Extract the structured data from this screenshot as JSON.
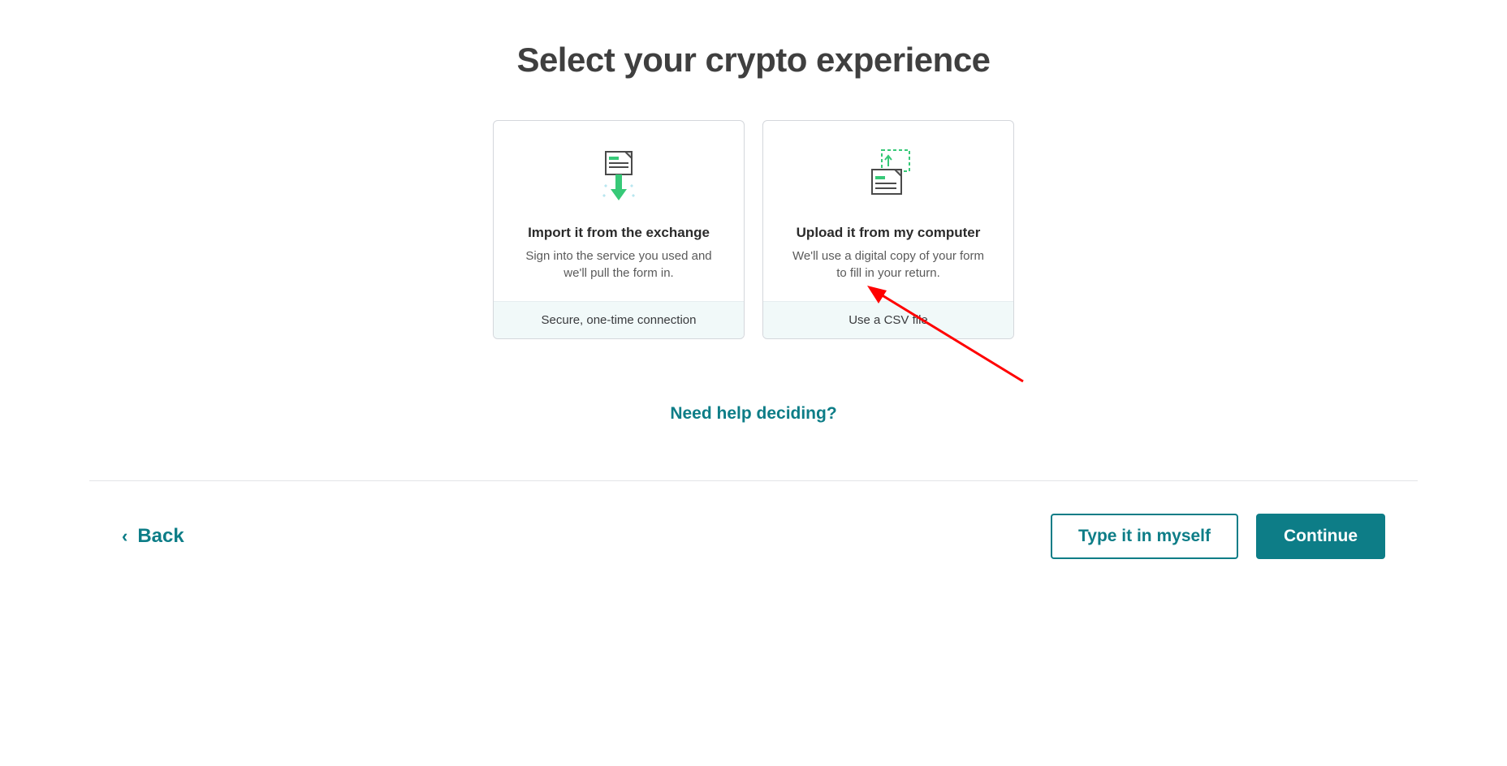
{
  "page": {
    "title": "Select your crypto experience"
  },
  "cards": {
    "import": {
      "title": "Import it from the exchange",
      "desc": "Sign into the service you used and we'll pull the form in.",
      "footer": "Secure, one-time connection"
    },
    "upload": {
      "title": "Upload it from my computer",
      "desc": "We'll use a digital copy of your form to fill in your return.",
      "footer": "Use a CSV file"
    }
  },
  "help_link": "Need help deciding?",
  "footer": {
    "back": "Back",
    "type_myself": "Type it in myself",
    "continue": "Continue"
  }
}
